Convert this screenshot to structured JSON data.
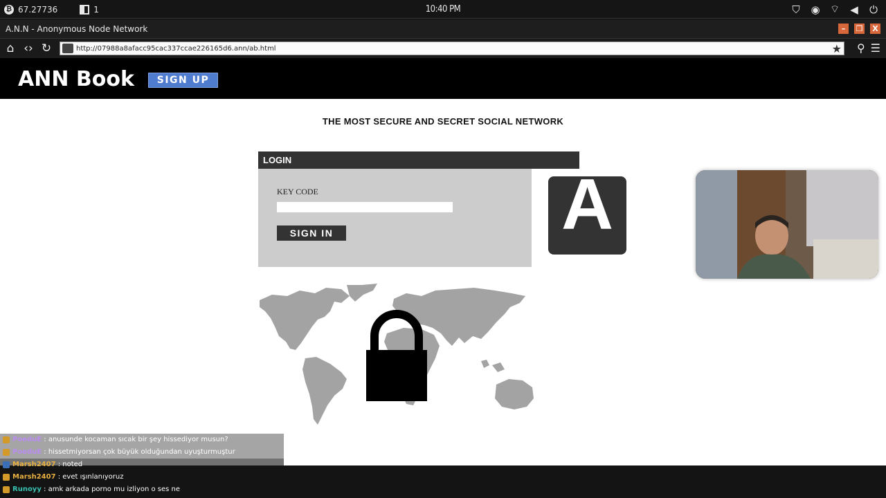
{
  "os": {
    "balance": "67.27736",
    "notif_count": "1",
    "clock": "10:40 PM"
  },
  "window": {
    "title": "A.N.N - Anonymous Node Network",
    "minimize": "–",
    "maximize": "❐",
    "close": "X"
  },
  "browser": {
    "url": "http://07988a8afacc95cac337ccae226165d6.ann/ab.html"
  },
  "site": {
    "brand": "ANN Book",
    "signup_label": "SIGN UP",
    "tagline": "THE MOST SECURE AND SECRET SOCIAL NETWORK",
    "login": {
      "heading": "LOGIN",
      "key_label": "KEY CODE",
      "key_value": "",
      "signin_label": "SIGN IN"
    },
    "logo_letter": "A"
  },
  "chat": [
    {
      "user": "PoeduE",
      "message": ": anusunde kocaman sıcak bir şey hissediyor musun?",
      "user_color": "#b98cf0",
      "badge": "gold"
    },
    {
      "user": "PoeduE",
      "message": ": hissetmiyorsan çok büyük olduğundan uyuşturmuştur",
      "user_color": "#b98cf0",
      "badge": "gold"
    },
    {
      "user": "Marsh2407",
      "message": ": noted",
      "user_color": "#e8b040",
      "badge": "blue"
    },
    {
      "user": "Marsh2407",
      "message": ": evet ışınlanıyoruz",
      "user_color": "#e8b040",
      "badge": "gold"
    },
    {
      "user": "Runoyy",
      "message": ": amk arkada porno mu izliyon o ses ne",
      "user_color": "#38c0b0",
      "badge": "gold"
    }
  ],
  "colors": {
    "signup_bg": "#4f7ccf",
    "login_head_bg": "#333333",
    "login_body_bg": "#cccccc",
    "map_gray": "#a3a3a3",
    "window_btn": "#d8683b"
  }
}
